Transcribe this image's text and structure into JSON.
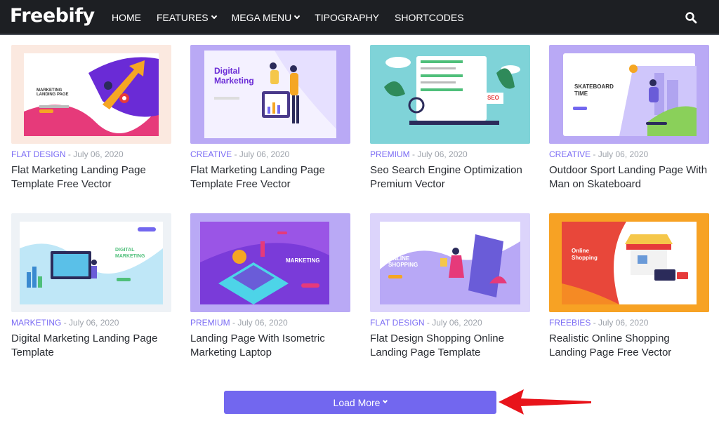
{
  "header": {
    "logo": "Freebify",
    "nav": [
      {
        "label": "HOME",
        "dropdown": false
      },
      {
        "label": "FEATURES",
        "dropdown": true
      },
      {
        "label": "MEGA MENU",
        "dropdown": true
      },
      {
        "label": "TIPOGRAPHY",
        "dropdown": false
      },
      {
        "label": "SHORTCODES",
        "dropdown": false
      }
    ],
    "search_icon": "search-icon"
  },
  "posts": [
    {
      "category": "FLAT DESIGN",
      "date": "- July 06, 2020",
      "title": "Flat Marketing Landing Page Template Free Vector",
      "thumb_label": "MARKETING LANDING PAGE"
    },
    {
      "category": "CREATIVE",
      "date": "- July 06, 2020",
      "title": "Flat Marketing Landing Page Template Free Vector",
      "thumb_label": "Digital Marketing"
    },
    {
      "category": "PREMIUM",
      "date": "- July 06, 2020",
      "title": "Seo Search Engine Optimization Premium Vector",
      "thumb_label": "SEO"
    },
    {
      "category": "CREATIVE",
      "date": "- July 06, 2020",
      "title": "Outdoor Sport Landing Page With Man on Skateboard",
      "thumb_label": "SKATEBOARD TIME"
    },
    {
      "category": "MARKETING",
      "date": "- July 06, 2020",
      "title": "Digital Marketing Landing Page Template",
      "thumb_label": "DIGITAL MARKETING"
    },
    {
      "category": "PREMIUM",
      "date": "- July 06, 2020",
      "title": "Landing Page With Isometric Marketing Laptop",
      "thumb_label": "MARKETING"
    },
    {
      "category": "FLAT DESIGN",
      "date": "- July 06, 2020",
      "title": "Flat Design Shopping Online Landing Page Template",
      "thumb_label": "ONLINE SHOPPING"
    },
    {
      "category": "FREEBIES",
      "date": "- July 06, 2020",
      "title": "Realistic Online Shopping Landing Page Free Vector",
      "thumb_label": "Online Shopping"
    }
  ],
  "load_more": {
    "label": "Load More"
  },
  "colors": {
    "accent": "#7267ef",
    "category": "#7b6cf4",
    "topbar": "#1d1f23",
    "arrow": "#e8141b"
  }
}
